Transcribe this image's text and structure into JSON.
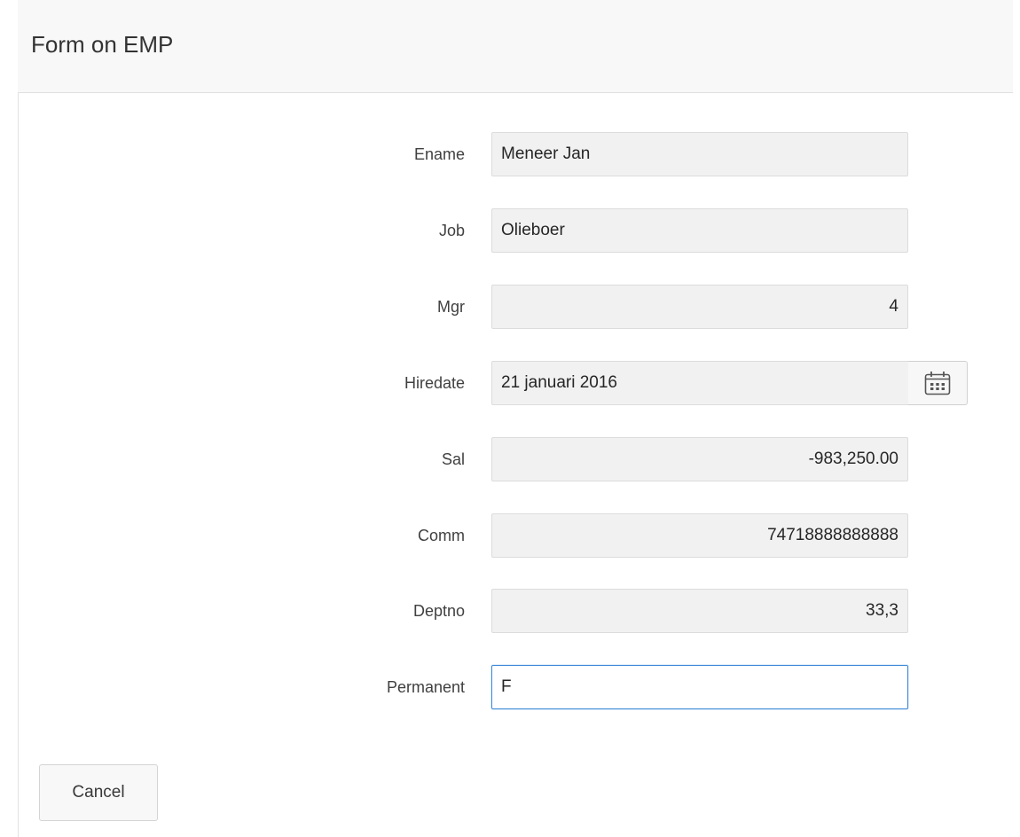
{
  "region": {
    "title": "Form on EMP"
  },
  "form": {
    "ename": {
      "label": "Ename",
      "value": "Meneer Jan"
    },
    "job": {
      "label": "Job",
      "value": "Olieboer"
    },
    "mgr": {
      "label": "Mgr",
      "value": "4"
    },
    "hiredate": {
      "label": "Hiredate",
      "value": "21 januari 2016",
      "picker_icon": "calendar-icon"
    },
    "sal": {
      "label": "Sal",
      "value": "-983,250.00"
    },
    "comm": {
      "label": "Comm",
      "value": "74718888888888"
    },
    "deptno": {
      "label": "Deptno",
      "value": "33,3"
    },
    "permanent": {
      "label": "Permanent",
      "value": "F"
    }
  },
  "buttons": {
    "cancel_label": "Cancel"
  },
  "colors": {
    "focus_border": "#3f8ad9",
    "field_bg": "#f1f1f1"
  }
}
